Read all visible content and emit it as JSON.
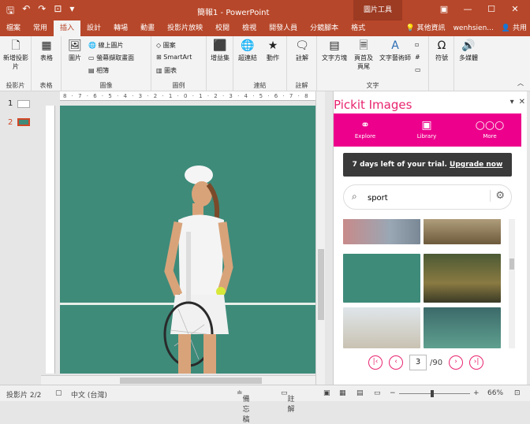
{
  "titlebar": {
    "title": "簡報1 - PowerPoint",
    "context_tab": "圖片工具"
  },
  "tabs": [
    "檔案",
    "常用",
    "插入",
    "設計",
    "轉場",
    "動畫",
    "投影片放映",
    "校閱",
    "檢視",
    "開發人員",
    "分鏡腳本",
    "格式"
  ],
  "tabs_right": {
    "tell": "其他資訊",
    "user": "wenhsien...",
    "share": "共用"
  },
  "ribbon": {
    "new_slide": "新增投影片",
    "table": "表格",
    "images": "圖片",
    "online_pictures": "線上圖片",
    "screenshot": "螢幕擷取畫面",
    "album": "相簿",
    "shapes": "圖案",
    "smartart": "SmartArt",
    "chart": "圖表",
    "addins": "增益集",
    "link": "超連結",
    "action": "動作",
    "comment": "註解",
    "textbox": "文字方塊",
    "header": "頁首及頁尾",
    "wordart": "文字藝術師",
    "symbols": "符號",
    "media": "多媒體",
    "groups": [
      "投影片",
      "表格",
      "圖像",
      "圖例",
      "連結",
      "註解",
      "文字"
    ]
  },
  "thumbs": [
    "1",
    "2"
  ],
  "ruler_text": "8 · 7 · 6 · 5 · 4 · 3 · 2 · 1 · 0 · 1 · 2 · 3 · 4 · 5 · 6 · 7 · 8",
  "pickit": {
    "title": "Pickit Images",
    "nav": [
      "Explore",
      "Library",
      "More"
    ],
    "trial_text": "7 days left of your trial.",
    "trial_link": "Upgrade now",
    "search_value": "sport",
    "page": "3",
    "total": "/90"
  },
  "status": {
    "slide": "投影片 2/2",
    "lang": "中文 (台灣)",
    "notes": "備忘稿",
    "comments": "註解",
    "zoom": "66%"
  }
}
